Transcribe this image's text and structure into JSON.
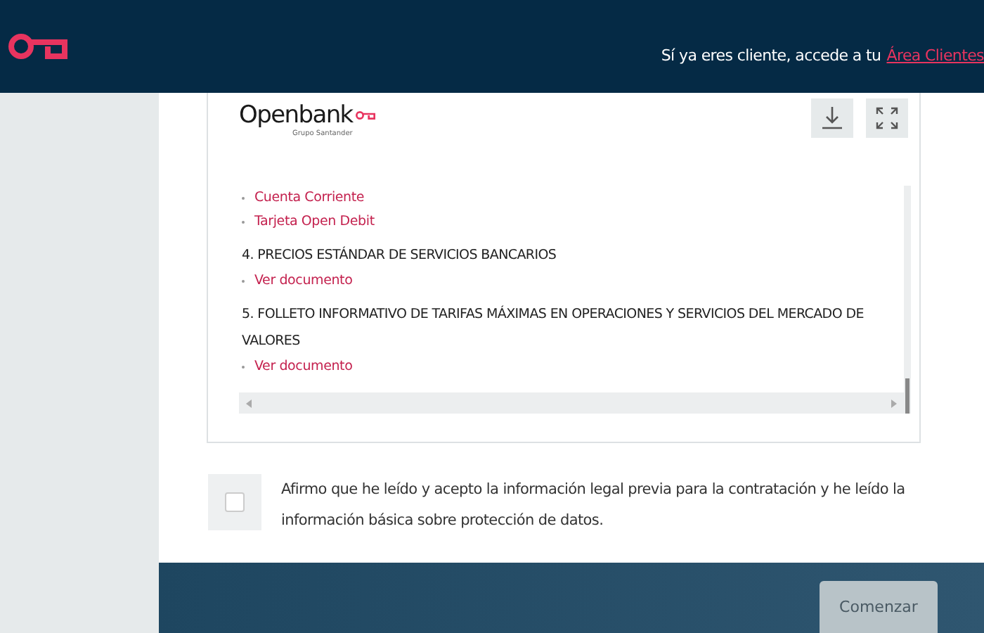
{
  "header": {
    "prompt": "Sí ya eres cliente, accede a tu",
    "link": "Área Clientes"
  },
  "document": {
    "logo": {
      "name": "Openbank",
      "subtitle": "Grupo Santander"
    },
    "items": [
      {
        "kind": "link",
        "text": "Cuenta Corriente"
      },
      {
        "kind": "link",
        "text": "Tarjeta Open Debit"
      },
      {
        "kind": "heading",
        "text": "4. PRECIOS ESTÁNDAR DE SERVICIOS BANCARIOS"
      },
      {
        "kind": "link",
        "text": "Ver documento"
      },
      {
        "kind": "heading",
        "text": "5. FOLLETO INFORMATIVO DE TARIFAS MÁXIMAS EN OPERACIONES Y SERVICIOS DEL MERCADO DE VALORES"
      },
      {
        "kind": "link",
        "text": "Ver documento"
      }
    ]
  },
  "consent": {
    "checked": false,
    "text": "Afirmo que he leído y acepto la información legal previa para la contratación y he leído la información básica sobre protección de datos."
  },
  "footer": {
    "button": {
      "label": "Comenzar",
      "disabled": true
    }
  }
}
